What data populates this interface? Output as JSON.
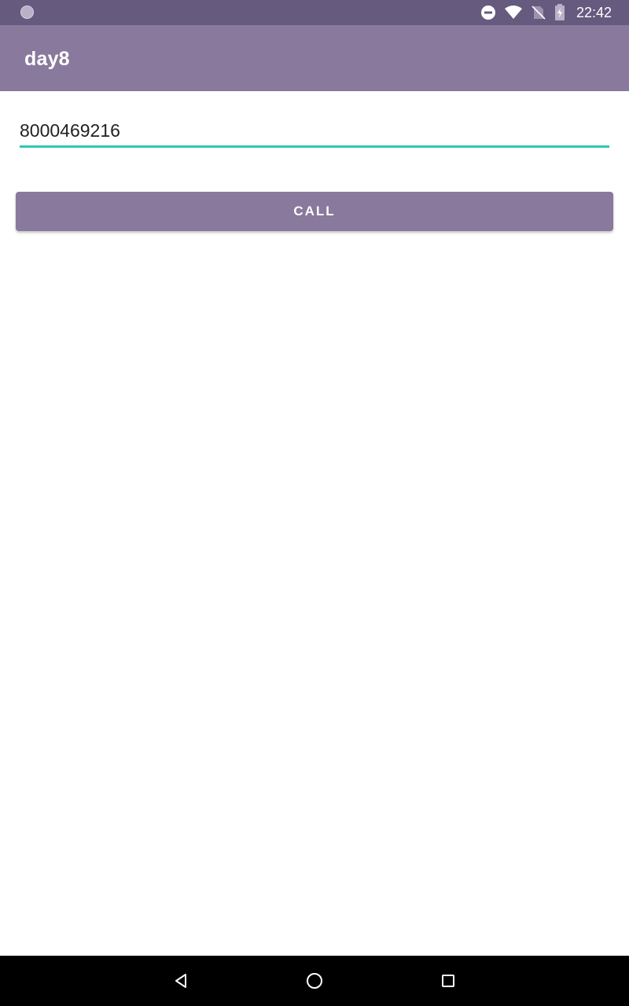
{
  "status_bar": {
    "time": "22:42",
    "icons": [
      "notification-dot-icon",
      "do-not-disturb-icon",
      "wifi-icon",
      "no-sim-icon",
      "battery-charging-icon"
    ]
  },
  "app_bar": {
    "title": "day8"
  },
  "form": {
    "phone_value": "8000469216",
    "call_label": "CALL"
  },
  "nav_bar": {
    "icons": [
      "back-icon",
      "home-icon",
      "recents-icon"
    ]
  },
  "colors": {
    "status_bar": "#665a7f",
    "primary": "#89799c",
    "accent": "#2fc7b5"
  }
}
